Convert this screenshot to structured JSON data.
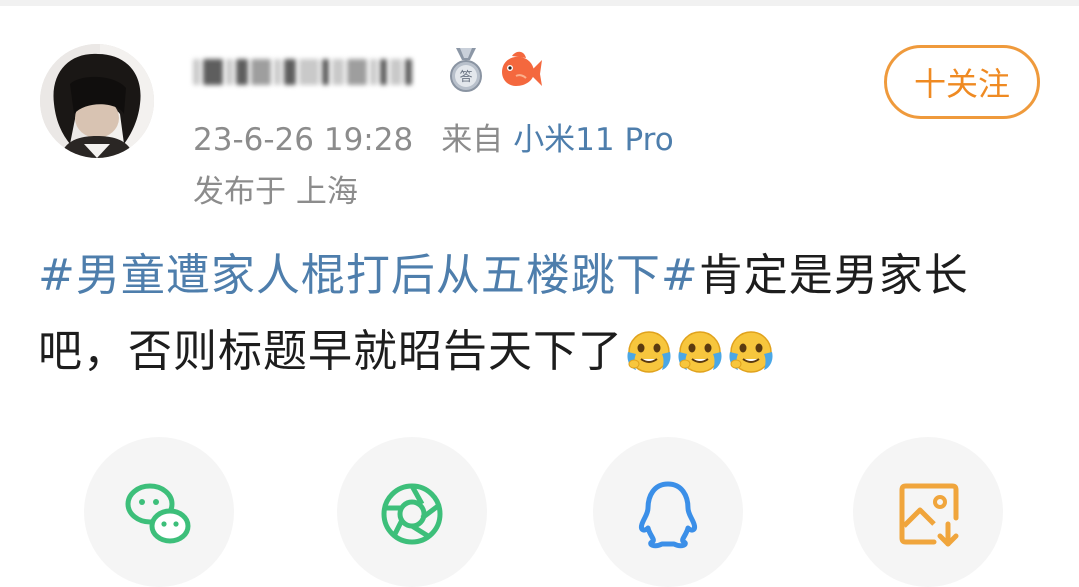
{
  "post": {
    "username": "",
    "badges": [
      "medal-icon",
      "koi-fish-icon"
    ],
    "timestamp": "23-6-26 19:28",
    "source_prefix": "来自",
    "device": "小米11 Pro",
    "location": "发布于 上海",
    "follow_label": "十关注",
    "hashtag": "#男童遭家人棍打后从五楼跳下#",
    "body_text": "肯定是男家长吧，否则标题早就昭告天下了",
    "emojis": [
      "crying-laugh-emoji",
      "crying-laugh-emoji",
      "crying-laugh-emoji"
    ]
  },
  "share_bar": {
    "items": [
      "wechat-icon",
      "moments-icon",
      "qq-icon",
      "save-image-icon"
    ]
  },
  "colors": {
    "link_blue": "#4e7eac",
    "follow_orange": "#ef8a22",
    "meta_gray": "#8c8c8c",
    "text": "#1d1d1d"
  }
}
